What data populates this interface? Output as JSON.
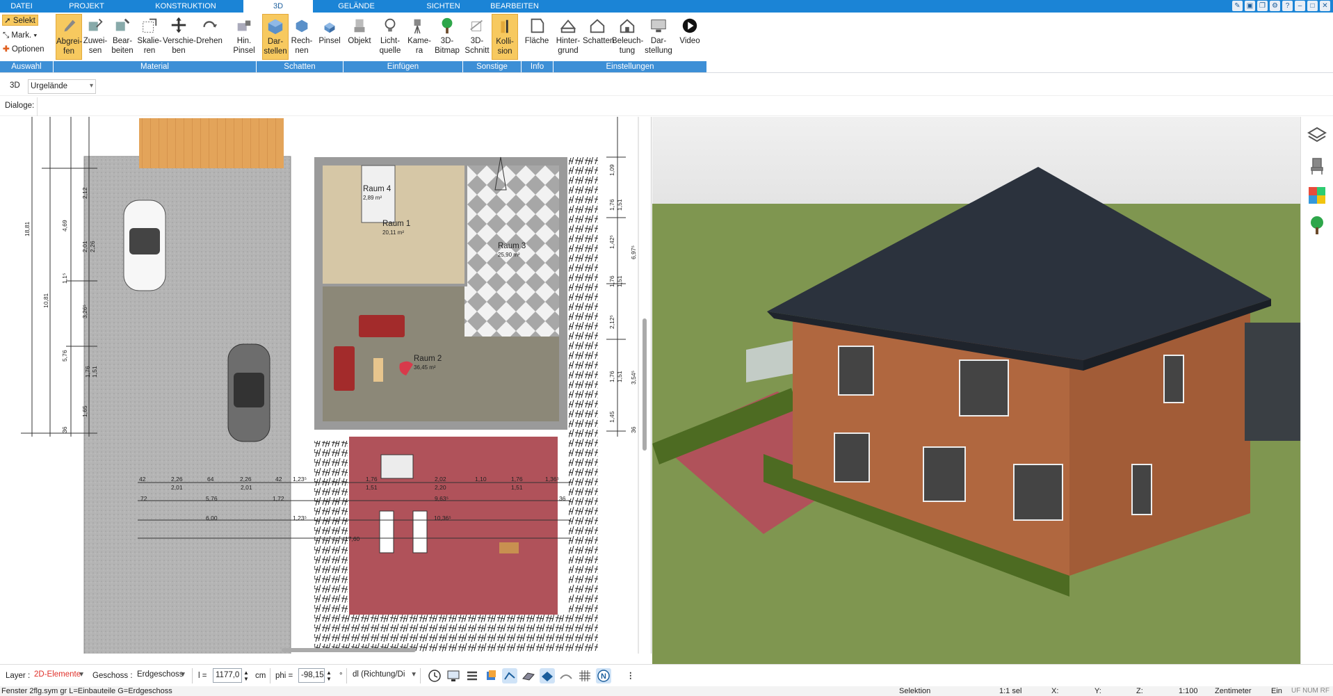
{
  "menu_tabs": [
    {
      "label": "DATEI"
    },
    {
      "label": "PROJEKT"
    },
    {
      "label": "KONSTRUKTION"
    },
    {
      "label": "3D"
    },
    {
      "label": "GELÄNDE"
    },
    {
      "label": "SICHTEN"
    },
    {
      "label": "BEARBEITEN"
    }
  ],
  "ribbon": {
    "auswahl": {
      "select": "Selekt",
      "mark": "Mark.",
      "options": "Optionen"
    },
    "buttons": [
      {
        "l1": "Abgrei-",
        "l2": "fen",
        "icon": "eyedropper-icon"
      },
      {
        "l1": "Zuwei-",
        "l2": "sen",
        "icon": "assign-material-icon"
      },
      {
        "l1": "Bear-",
        "l2": "beiten",
        "icon": "edit-material-icon"
      },
      {
        "l1": "Skalie-",
        "l2": "ren",
        "icon": "scale-icon"
      },
      {
        "l1": "Verschie-",
        "l2": "ben",
        "icon": "move-icon"
      },
      {
        "l1": "Drehen",
        "l2": "",
        "icon": "rotate-icon"
      },
      {
        "l1": "Hin.",
        "l2": "Pinsel",
        "icon": "background-brush-icon"
      },
      {
        "l1": "Dar-",
        "l2": "stellen",
        "icon": "shadow-display-icon"
      },
      {
        "l1": "Rech-",
        "l2": "nen",
        "icon": "shadow-calculate-icon"
      },
      {
        "l1": "Pinsel",
        "l2": "",
        "icon": "brush-icon"
      },
      {
        "l1": "Objekt",
        "l2": "",
        "icon": "object-icon"
      },
      {
        "l1": "Licht-",
        "l2": "quelle",
        "icon": "light-bulb-icon"
      },
      {
        "l1": "Kame-",
        "l2": "ra",
        "icon": "camera-icon"
      },
      {
        "l1": "3D-",
        "l2": "Bitmap",
        "icon": "tree-bitmap-icon"
      },
      {
        "l1": "3D-",
        "l2": "Schnitt",
        "icon": "section-cut-icon"
      },
      {
        "l1": "Kolli-",
        "l2": "sion",
        "icon": "collision-icon"
      },
      {
        "l1": "Fläche",
        "l2": "",
        "icon": "area-icon"
      },
      {
        "l1": "Hinter-",
        "l2": "grund",
        "icon": "background-icon"
      },
      {
        "l1": "Schatten",
        "l2": "",
        "icon": "shadow-house-icon"
      },
      {
        "l1": "Beleuch-",
        "l2": "tung",
        "icon": "lighting-icon"
      },
      {
        "l1": "Dar-",
        "l2": "stellung",
        "icon": "display-monitor-icon"
      },
      {
        "l1": "Video",
        "l2": "",
        "icon": "video-play-icon"
      }
    ],
    "groups": [
      {
        "label": "Auswahl"
      },
      {
        "label": "Material"
      },
      {
        "label": "Schatten"
      },
      {
        "label": "Einfügen"
      },
      {
        "label": "Sonstige"
      },
      {
        "label": "Info"
      },
      {
        "label": "Einstellungen"
      }
    ]
  },
  "viewbar": {
    "mode": "3D",
    "dropdown": "Urgelände"
  },
  "dialogbar": {
    "label": "Dialoge:"
  },
  "plan": {
    "rooms": [
      {
        "name": "Raum 4",
        "area": "2,89 m²"
      },
      {
        "name": "Raum 1",
        "area": "20,11 m²"
      },
      {
        "name": "Raum 3",
        "area": "25,90 m²"
      },
      {
        "name": "Raum 2",
        "area": "36,45 m²"
      }
    ],
    "dims_left": [
      "18,81",
      "10,81",
      "4,69",
      "2,01",
      "2,26",
      "1,1⁵",
      "3,26⁵",
      "5,76",
      "1,76",
      "1,51",
      "1,65",
      "36",
      "2,12"
    ],
    "dims_right": [
      "1,09",
      "1,76",
      "1,51",
      "1,42⁵",
      "6,97⁵",
      "1,76",
      "1,51",
      "2,12⁵",
      "1,76",
      "1,51",
      "3,54⁵",
      "1,45",
      "36"
    ],
    "dims_bottom": [
      "42",
      "2,26",
      "64",
      "2,26",
      "42",
      "1,23⁵",
      "2,01",
      "2,01",
      "72",
      "5,76",
      "1,72",
      "6,00",
      "1,23⁵",
      "1,76",
      "1,51",
      "2,02",
      "2,20",
      "1,10",
      "1,76",
      "1,51",
      "1,36⁵",
      "9,63⁵",
      "36",
      "10,36⁵",
      "17,60"
    ]
  },
  "bottombar": {
    "layer_label": "Layer :",
    "layer_value": "2D-Elemente",
    "geschoss_label": "Geschoss :",
    "geschoss_value": "Erdgeschoss",
    "l_label": "l =",
    "l_value": "1177,0",
    "l_unit": "cm",
    "phi_label": "phi =",
    "phi_value": "-98,15",
    "phi_unit": "°",
    "dl_value": "dl (Richtung/Di"
  },
  "statusbar": {
    "left": "Fenster 2flg.sym gr L=Einbauteile G=Erdgeschoss",
    "selektion": "Selektion",
    "sel": "1:1 sel",
    "x": "X:",
    "y": "Y:",
    "z": "Z:",
    "scale": "1:100",
    "unit": "Zentimeter",
    "ein": "Ein",
    "flags": "UF NUM RF"
  },
  "colors": {
    "accent": "#1b84d6",
    "group_bar": "#3d8fd6",
    "active_button": "#f7c95f",
    "terrace": "#b0525a",
    "house_wall": "#b0673f",
    "roof": "#2b323d",
    "grass": "#7f9650"
  }
}
